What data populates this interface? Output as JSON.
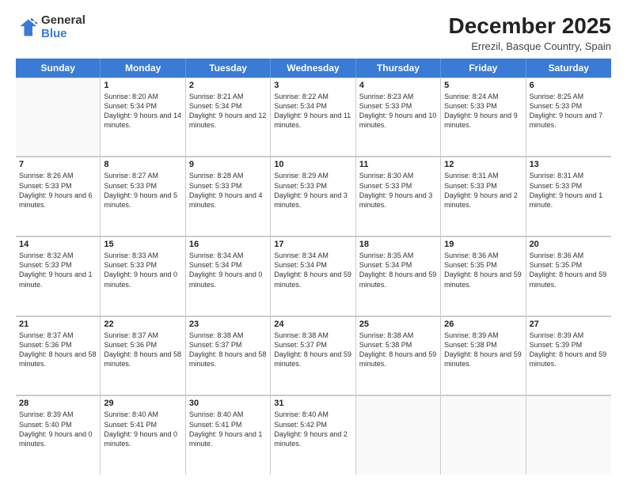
{
  "logo": {
    "general": "General",
    "blue": "Blue"
  },
  "title": "December 2025",
  "subtitle": "Errezil, Basque Country, Spain",
  "days": [
    "Sunday",
    "Monday",
    "Tuesday",
    "Wednesday",
    "Thursday",
    "Friday",
    "Saturday"
  ],
  "weeks": [
    [
      {
        "day": "",
        "empty": true
      },
      {
        "day": "1",
        "sunrise": "Sunrise: 8:20 AM",
        "sunset": "Sunset: 5:34 PM",
        "daylight": "Daylight: 9 hours and 14 minutes."
      },
      {
        "day": "2",
        "sunrise": "Sunrise: 8:21 AM",
        "sunset": "Sunset: 5:34 PM",
        "daylight": "Daylight: 9 hours and 12 minutes."
      },
      {
        "day": "3",
        "sunrise": "Sunrise: 8:22 AM",
        "sunset": "Sunset: 5:34 PM",
        "daylight": "Daylight: 9 hours and 11 minutes."
      },
      {
        "day": "4",
        "sunrise": "Sunrise: 8:23 AM",
        "sunset": "Sunset: 5:33 PM",
        "daylight": "Daylight: 9 hours and 10 minutes."
      },
      {
        "day": "5",
        "sunrise": "Sunrise: 8:24 AM",
        "sunset": "Sunset: 5:33 PM",
        "daylight": "Daylight: 9 hours and 9 minutes."
      },
      {
        "day": "6",
        "sunrise": "Sunrise: 8:25 AM",
        "sunset": "Sunset: 5:33 PM",
        "daylight": "Daylight: 9 hours and 7 minutes."
      }
    ],
    [
      {
        "day": "7",
        "sunrise": "Sunrise: 8:26 AM",
        "sunset": "Sunset: 5:33 PM",
        "daylight": "Daylight: 9 hours and 6 minutes."
      },
      {
        "day": "8",
        "sunrise": "Sunrise: 8:27 AM",
        "sunset": "Sunset: 5:33 PM",
        "daylight": "Daylight: 9 hours and 5 minutes."
      },
      {
        "day": "9",
        "sunrise": "Sunrise: 8:28 AM",
        "sunset": "Sunset: 5:33 PM",
        "daylight": "Daylight: 9 hours and 4 minutes."
      },
      {
        "day": "10",
        "sunrise": "Sunrise: 8:29 AM",
        "sunset": "Sunset: 5:33 PM",
        "daylight": "Daylight: 9 hours and 3 minutes."
      },
      {
        "day": "11",
        "sunrise": "Sunrise: 8:30 AM",
        "sunset": "Sunset: 5:33 PM",
        "daylight": "Daylight: 9 hours and 3 minutes."
      },
      {
        "day": "12",
        "sunrise": "Sunrise: 8:31 AM",
        "sunset": "Sunset: 5:33 PM",
        "daylight": "Daylight: 9 hours and 2 minutes."
      },
      {
        "day": "13",
        "sunrise": "Sunrise: 8:31 AM",
        "sunset": "Sunset: 5:33 PM",
        "daylight": "Daylight: 9 hours and 1 minute."
      }
    ],
    [
      {
        "day": "14",
        "sunrise": "Sunrise: 8:32 AM",
        "sunset": "Sunset: 5:33 PM",
        "daylight": "Daylight: 9 hours and 1 minute."
      },
      {
        "day": "15",
        "sunrise": "Sunrise: 8:33 AM",
        "sunset": "Sunset: 5:33 PM",
        "daylight": "Daylight: 9 hours and 0 minutes."
      },
      {
        "day": "16",
        "sunrise": "Sunrise: 8:34 AM",
        "sunset": "Sunset: 5:34 PM",
        "daylight": "Daylight: 9 hours and 0 minutes."
      },
      {
        "day": "17",
        "sunrise": "Sunrise: 8:34 AM",
        "sunset": "Sunset: 5:34 PM",
        "daylight": "Daylight: 8 hours and 59 minutes."
      },
      {
        "day": "18",
        "sunrise": "Sunrise: 8:35 AM",
        "sunset": "Sunset: 5:34 PM",
        "daylight": "Daylight: 8 hours and 59 minutes."
      },
      {
        "day": "19",
        "sunrise": "Sunrise: 8:36 AM",
        "sunset": "Sunset: 5:35 PM",
        "daylight": "Daylight: 8 hours and 59 minutes."
      },
      {
        "day": "20",
        "sunrise": "Sunrise: 8:36 AM",
        "sunset": "Sunset: 5:35 PM",
        "daylight": "Daylight: 8 hours and 59 minutes."
      }
    ],
    [
      {
        "day": "21",
        "sunrise": "Sunrise: 8:37 AM",
        "sunset": "Sunset: 5:36 PM",
        "daylight": "Daylight: 8 hours and 58 minutes."
      },
      {
        "day": "22",
        "sunrise": "Sunrise: 8:37 AM",
        "sunset": "Sunset: 5:36 PM",
        "daylight": "Daylight: 8 hours and 58 minutes."
      },
      {
        "day": "23",
        "sunrise": "Sunrise: 8:38 AM",
        "sunset": "Sunset: 5:37 PM",
        "daylight": "Daylight: 8 hours and 58 minutes."
      },
      {
        "day": "24",
        "sunrise": "Sunrise: 8:38 AM",
        "sunset": "Sunset: 5:37 PM",
        "daylight": "Daylight: 8 hours and 59 minutes."
      },
      {
        "day": "25",
        "sunrise": "Sunrise: 8:38 AM",
        "sunset": "Sunset: 5:38 PM",
        "daylight": "Daylight: 8 hours and 59 minutes."
      },
      {
        "day": "26",
        "sunrise": "Sunrise: 8:39 AM",
        "sunset": "Sunset: 5:38 PM",
        "daylight": "Daylight: 8 hours and 59 minutes."
      },
      {
        "day": "27",
        "sunrise": "Sunrise: 8:39 AM",
        "sunset": "Sunset: 5:39 PM",
        "daylight": "Daylight: 8 hours and 59 minutes."
      }
    ],
    [
      {
        "day": "28",
        "sunrise": "Sunrise: 8:39 AM",
        "sunset": "Sunset: 5:40 PM",
        "daylight": "Daylight: 9 hours and 0 minutes."
      },
      {
        "day": "29",
        "sunrise": "Sunrise: 8:40 AM",
        "sunset": "Sunset: 5:41 PM",
        "daylight": "Daylight: 9 hours and 0 minutes."
      },
      {
        "day": "30",
        "sunrise": "Sunrise: 8:40 AM",
        "sunset": "Sunset: 5:41 PM",
        "daylight": "Daylight: 9 hours and 1 minute."
      },
      {
        "day": "31",
        "sunrise": "Sunrise: 8:40 AM",
        "sunset": "Sunset: 5:42 PM",
        "daylight": "Daylight: 9 hours and 2 minutes."
      },
      {
        "day": "",
        "empty": true
      },
      {
        "day": "",
        "empty": true
      },
      {
        "day": "",
        "empty": true
      }
    ]
  ]
}
